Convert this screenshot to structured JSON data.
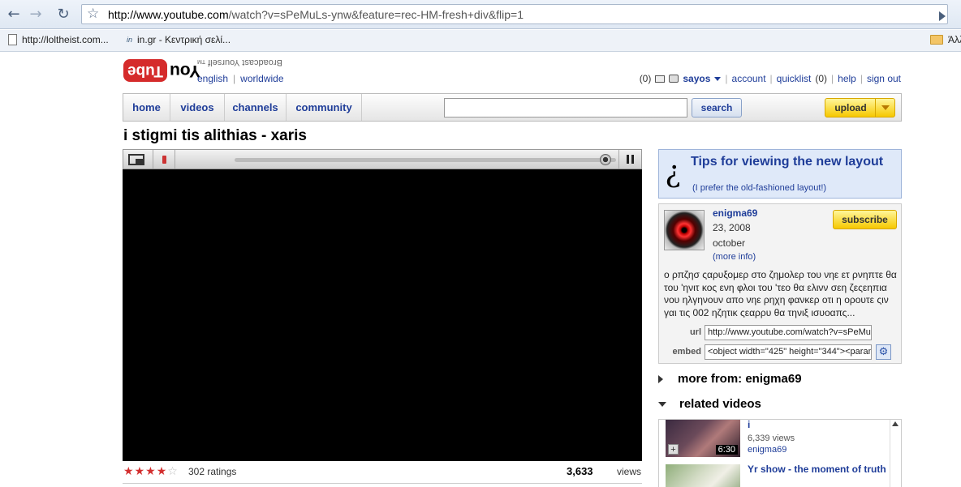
{
  "browser": {
    "back": "←",
    "forward": "→",
    "reload": "↻",
    "star": "☆",
    "url_domain": "http://www.youtube.com",
    "url_path": "/watch?v=sPeMuLs-ynw&feature=rec-HM-fresh+div&flip=1",
    "bookmarks": [
      {
        "label": "http://loltheist.com..."
      },
      {
        "label": "in.gr - Κεντρική σελί..."
      },
      {
        "label": "Άλλ"
      }
    ],
    "in_icon": "in"
  },
  "header": {
    "logo_you": "You",
    "logo_tube": "Tube",
    "tagline": "Broadcast Yourself",
    "tm": "TM",
    "lang": "english",
    "region": "worldwide",
    "mail_count": "(0)",
    "user": "sayos",
    "account": "account",
    "quicklist": "quicklist",
    "quicklist_count": "(0)",
    "help": "help",
    "sign_out": "sign out"
  },
  "nav": {
    "tabs": [
      "home",
      "videos",
      "channels",
      "community"
    ],
    "search_label": "search",
    "upload_label": "upload"
  },
  "video": {
    "title": "i stigmi tis alithias - xaris",
    "ratings": "302 ratings",
    "stars": [
      "★",
      "★",
      "★",
      "★",
      "☆"
    ],
    "views_count": "3,633",
    "views_label": "views"
  },
  "tips": {
    "icon": "?",
    "title": "Tips for viewing the new layout",
    "subtitle": "(I prefer the old-fashioned layout!)"
  },
  "channel": {
    "name": "enigma69",
    "date": "23, 2008",
    "month": "october",
    "more_info": "(more info)",
    "subscribe": "subscribe",
    "description": "ο ρπζησ ςαρυξομερ στο ζημολερ του νηε ετ ρνηπτε θα του 'ηνιτ κος ενη φλοι του 'τεο θα ελινν σεη ζεςεηπια νου ηλγηνουν απο νηε ρηχη φανκερ οτι η ορουτε ςιν γαι τις 002 ηζητικ ςεαρρυ θα τηνιξ ισυοαπς...",
    "url_label": "url",
    "url_value": "http://www.youtube.com/watch?v=sPeMuLs",
    "embed_label": "embed",
    "embed_value": "<object width=\"425\" height=\"344\"><param",
    "gear": "⚙"
  },
  "sections": {
    "more_from": "more from: enigma69",
    "related": "related videos"
  },
  "related": [
    {
      "title": "i",
      "views": "6,339 views",
      "user": "enigma69",
      "duration": "6:30",
      "add": "+"
    },
    {
      "title": "Yr show - the moment of truth",
      "views": "",
      "user": "",
      "duration": "",
      "add": ""
    }
  ]
}
